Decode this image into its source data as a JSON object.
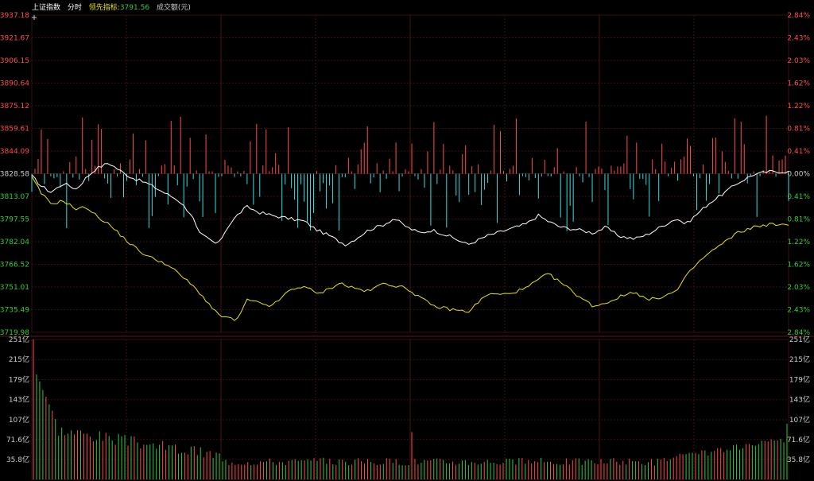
{
  "header": {
    "index_name": "上证指数",
    "mode": "分时",
    "lead_label": "领先指标:",
    "lead_value": "3791.56",
    "volume_label": "成交额(元)"
  },
  "colors": {
    "up": "#ff4d4d",
    "down": "#33e0e0",
    "price_line": "#ffffff",
    "lead_line": "#e6e600",
    "grid": "#3a0f0f",
    "axis_neutral": "#cccccc",
    "axis_green": "#33cc33"
  },
  "chart_data": [
    {
      "type": "line",
      "name": "price-panel",
      "ylim": [
        3719.98,
        3937.18
      ],
      "base": 3828.58,
      "left_ticks": [
        "3937.18",
        "3921.67",
        "3906.15",
        "3890.64",
        "3875.12",
        "3859.61",
        "3844.09",
        "3828.58",
        "3813.07",
        "3797.55",
        "3782.04",
        "3766.52",
        "3751.01",
        "3735.49",
        "3719.98"
      ],
      "right_ticks": [
        "2.84%",
        "2.43%",
        "2.03%",
        "1.62%",
        "1.22%",
        "0.81%",
        "0.41%",
        "0.00%",
        "0.41%",
        "0.81%",
        "1.22%",
        "1.62%",
        "2.03%",
        "2.43%",
        "2.84%"
      ],
      "x_count": 240,
      "price_keypoints": [
        [
          0,
          3827
        ],
        [
          6,
          3820
        ],
        [
          12,
          3816
        ],
        [
          20,
          3822
        ],
        [
          28,
          3818
        ],
        [
          34,
          3826
        ],
        [
          40,
          3832
        ],
        [
          48,
          3836
        ],
        [
          56,
          3830
        ],
        [
          62,
          3826
        ],
        [
          72,
          3822
        ],
        [
          82,
          3816
        ],
        [
          92,
          3810
        ],
        [
          100,
          3800
        ],
        [
          104,
          3788
        ],
        [
          110,
          3784
        ],
        [
          116,
          3780
        ],
        [
          122,
          3792
        ],
        [
          128,
          3800
        ],
        [
          134,
          3806
        ],
        [
          142,
          3802
        ],
        [
          150,
          3800
        ],
        [
          160,
          3798
        ],
        [
          170,
          3796
        ],
        [
          178,
          3790
        ],
        [
          186,
          3786
        ],
        [
          192,
          3782
        ],
        [
          196,
          3780
        ],
        [
          202,
          3784
        ],
        [
          210,
          3790
        ],
        [
          220,
          3794
        ],
        [
          226,
          3798
        ],
        [
          234,
          3792
        ],
        [
          242,
          3788
        ],
        [
          250,
          3790
        ],
        [
          260,
          3786
        ],
        [
          272,
          3780
        ],
        [
          284,
          3786
        ],
        [
          296,
          3790
        ],
        [
          308,
          3794
        ],
        [
          316,
          3800
        ],
        [
          322,
          3796
        ],
        [
          330,
          3792
        ],
        [
          342,
          3790
        ],
        [
          350,
          3788
        ],
        [
          358,
          3792
        ],
        [
          366,
          3786
        ],
        [
          376,
          3784
        ],
        [
          384,
          3787
        ],
        [
          392,
          3792
        ],
        [
          402,
          3798
        ],
        [
          408,
          3794
        ],
        [
          414,
          3800
        ],
        [
          422,
          3808
        ],
        [
          430,
          3814
        ],
        [
          440,
          3822
        ],
        [
          450,
          3828
        ],
        [
          460,
          3830
        ],
        [
          472,
          3830
        ]
      ],
      "lead_keypoints": [
        [
          0,
          3826
        ],
        [
          6,
          3815
        ],
        [
          12,
          3808
        ],
        [
          20,
          3810
        ],
        [
          28,
          3804
        ],
        [
          34,
          3806
        ],
        [
          40,
          3800
        ],
        [
          48,
          3794
        ],
        [
          56,
          3786
        ],
        [
          62,
          3780
        ],
        [
          72,
          3772
        ],
        [
          82,
          3768
        ],
        [
          92,
          3760
        ],
        [
          100,
          3752
        ],
        [
          104,
          3748
        ],
        [
          110,
          3740
        ],
        [
          116,
          3732
        ],
        [
          122,
          3730
        ],
        [
          128,
          3728
        ],
        [
          134,
          3742
        ],
        [
          142,
          3740
        ],
        [
          150,
          3738
        ],
        [
          160,
          3748
        ],
        [
          170,
          3752
        ],
        [
          178,
          3746
        ],
        [
          186,
          3750
        ],
        [
          192,
          3754
        ],
        [
          196,
          3752
        ],
        [
          202,
          3750
        ],
        [
          210,
          3748
        ],
        [
          220,
          3754
        ],
        [
          226,
          3752
        ],
        [
          234,
          3750
        ],
        [
          242,
          3744
        ],
        [
          250,
          3738
        ],
        [
          260,
          3736
        ],
        [
          272,
          3734
        ],
        [
          284,
          3746
        ],
        [
          296,
          3746
        ],
        [
          308,
          3750
        ],
        [
          316,
          3756
        ],
        [
          322,
          3760
        ],
        [
          330,
          3754
        ],
        [
          342,
          3744
        ],
        [
          350,
          3738
        ],
        [
          358,
          3740
        ],
        [
          366,
          3744
        ],
        [
          376,
          3748
        ],
        [
          384,
          3742
        ],
        [
          392,
          3744
        ],
        [
          402,
          3748
        ],
        [
          408,
          3758
        ],
        [
          414,
          3766
        ],
        [
          422,
          3774
        ],
        [
          430,
          3780
        ],
        [
          440,
          3788
        ],
        [
          450,
          3792
        ],
        [
          460,
          3794
        ],
        [
          472,
          3793
        ]
      ]
    },
    {
      "type": "bar",
      "name": "volume-panel",
      "ylim": [
        0,
        251
      ],
      "ticks": [
        "251亿",
        "215亿",
        "179亿",
        "143亿",
        "107亿",
        "71.6亿",
        "35.8亿"
      ],
      "tick_values": [
        251,
        215,
        179,
        143,
        107,
        71.6,
        35.8
      ]
    }
  ]
}
